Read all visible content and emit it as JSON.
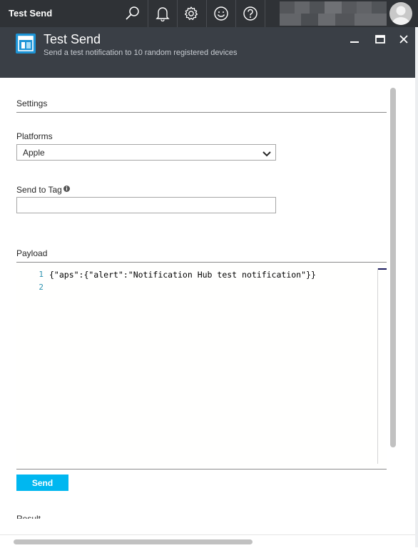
{
  "topbar": {
    "title": "Test Send",
    "icons": [
      "search-icon",
      "bell-icon",
      "gear-icon",
      "smiley-icon",
      "help-icon"
    ]
  },
  "blade": {
    "title": "Test Send",
    "subtitle": "Send a test notification to 10 random registered devices",
    "window_controls": [
      "minimize-icon",
      "maximize-icon",
      "close-icon"
    ]
  },
  "settings": {
    "label": "Settings"
  },
  "platforms": {
    "label": "Platforms",
    "selected": "Apple"
  },
  "send_to_tag": {
    "label": "Send to Tag",
    "value": "",
    "placeholder": ""
  },
  "payload": {
    "label": "Payload",
    "lines": [
      {
        "number": "1",
        "text": "{\"aps\":{\"alert\":\"Notification Hub test notification\"}}"
      },
      {
        "number": "2",
        "text": ""
      }
    ]
  },
  "actions": {
    "send_label": "Send"
  },
  "result": {
    "label": "Result"
  },
  "colors": {
    "accent": "#00b7f0",
    "topbar": "#2f3236",
    "header": "#3a3f46"
  }
}
